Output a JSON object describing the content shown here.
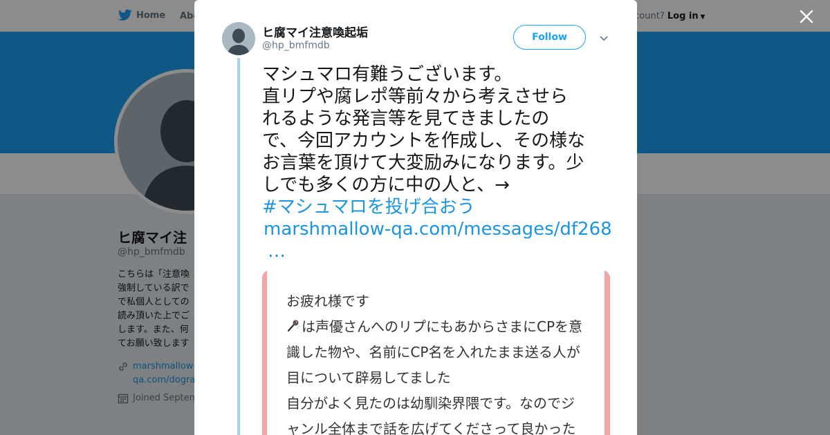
{
  "background_page": {
    "nav": {
      "home_label": "Home",
      "about_label": "Abo",
      "account_prompt": "ccount?",
      "login_label": "Log in"
    },
    "profile": {
      "name": "ヒ腐マイ注",
      "handle": "@hp_bmfmdb",
      "bio_lines": [
        "こちらは「注意喚",
        "強制している訳で",
        "で私個人としての",
        "読み頂いた上でご",
        "します。また、何",
        "てお願い致します"
      ],
      "link_lines": [
        "marshmallow-",
        "qa.com/dogra"
      ],
      "joined": "Joined Septen"
    }
  },
  "modal": {
    "author": {
      "name": "ヒ腐マイ注意喚起垢",
      "handle": "@hp_bmfmdb"
    },
    "follow_label": "Follow",
    "tweet": {
      "lines": [
        "マシュマロ有難うございます。",
        "直リプや腐レポ等前々から考えさせら",
        "れるような発言等を見てきましたの",
        "で、今回アカウントを作成し、その様な",
        "お言葉を頂けて大変励みになります。少",
        "しでも多くの方に中の人と、→"
      ],
      "hashtag": "#マシュマロを投げ合おう",
      "url": "marshmallow-qa.com/messages/df268",
      "ellipsis": "…"
    },
    "card": {
      "lines": [
        "お疲れ様です",
        "は声優さんへのリプにもあからさまにCPを意",
        "識した物や、名前にCP名を入れたまま送る人が",
        "目について辟易してました",
        "自分がよく見たのは幼馴染界隈です。なのでジ",
        "ャンル全体まで話を広げてくださって良かった"
      ]
    }
  },
  "colors": {
    "brand_blue": "#1da1f2",
    "link_blue": "#1b95e0",
    "thread_line": "#a5d2f1",
    "card_border": "#f4a5a9"
  },
  "icons": [
    "twitter-bird-icon",
    "close-icon",
    "chevron-down-icon",
    "link-icon",
    "calendar-icon",
    "microphone-icon"
  ]
}
